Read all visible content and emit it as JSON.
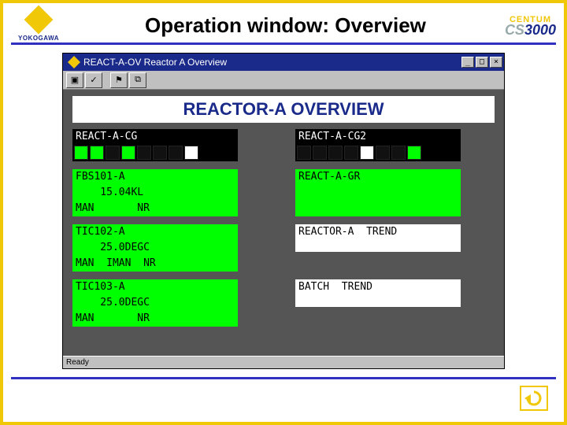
{
  "slide": {
    "title": "Operation window: Overview",
    "brand_left": "YOKOGAWA",
    "brand_right_top": "CENTUM",
    "brand_right_bottom_cs": "CS",
    "brand_right_bottom_num": "3000"
  },
  "window": {
    "title": "REACT-A-OV Reactor A Overview",
    "min": "_",
    "max": "□",
    "close": "×",
    "statusbar": "Ready",
    "page_title": "REACTOR-A  OVERVIEW"
  },
  "tiles": {
    "left": [
      {
        "header": "REACT-A-CG",
        "squares": [
          "g",
          "g",
          "d",
          "g",
          "d",
          "d",
          "d",
          "w"
        ]
      },
      {
        "header": "FBS101-A",
        "line1": "    15.04KL",
        "line2": "MAN       NR"
      },
      {
        "header": "TIC102-A",
        "line1": "    25.0DEGC",
        "line2": "MAN  IMAN  NR"
      },
      {
        "header": "TIC103-A",
        "line1": "    25.0DEGC",
        "line2": "MAN       NR"
      }
    ],
    "right": [
      {
        "header": "REACT-A-CG2",
        "squares": [
          "d",
          "d",
          "d",
          "d",
          "w",
          "d",
          "d",
          "g"
        ]
      },
      {
        "header": "REACT-A-GR",
        "line1": " ",
        "line2": " "
      },
      {
        "header": "REACTOR-A  TREND",
        "line1": " "
      },
      {
        "header": "BATCH  TREND",
        "line1": " "
      }
    ]
  }
}
